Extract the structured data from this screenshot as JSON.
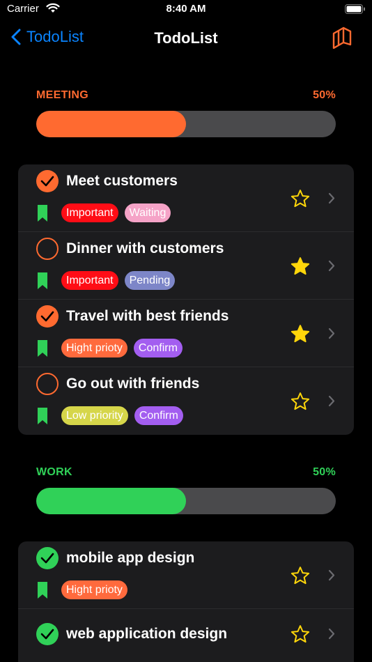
{
  "status_bar": {
    "carrier": "Carrier",
    "time": "8:40 AM"
  },
  "nav": {
    "back_label": "TodoList",
    "title": "TodoList",
    "action_icon": "cards-stack-icon"
  },
  "colors": {
    "accent_orange": "#ff6a30",
    "accent_green": "#30d158",
    "star_yellow": "#ffd60a",
    "bookmark_green": "#30d158"
  },
  "sections": [
    {
      "name": "MEETING",
      "percent_label": "50%",
      "progress": 0.5,
      "color": "#ff6a30",
      "items": [
        {
          "title": "Meet customers",
          "done": true,
          "starred": false,
          "tags": [
            {
              "label": "Important",
              "color": "#ff0d16"
            },
            {
              "label": "Waiting",
              "color": "#f5a3c7"
            }
          ]
        },
        {
          "title": "Dinner with customers",
          "done": false,
          "starred": true,
          "tags": [
            {
              "label": "Important",
              "color": "#ff0d16"
            },
            {
              "label": "Pending",
              "color": "#7d86c8"
            }
          ]
        },
        {
          "title": "Travel with best friends",
          "done": true,
          "starred": true,
          "tags": [
            {
              "label": "Hight prioty",
              "color": "#ff6a3d"
            },
            {
              "label": "Confirm",
              "color": "#a35ef0"
            }
          ]
        },
        {
          "title": "Go out with friends",
          "done": false,
          "starred": false,
          "tags": [
            {
              "label": "Low priority",
              "color": "#d6d64a"
            },
            {
              "label": "Confirm",
              "color": "#a35ef0"
            }
          ]
        }
      ]
    },
    {
      "name": "WORK",
      "percent_label": "50%",
      "progress": 0.5,
      "color": "#30d158",
      "items": [
        {
          "title": "mobile app design",
          "done": true,
          "starred": false,
          "tags": [
            {
              "label": "Hight prioty",
              "color": "#ff6a3d"
            }
          ]
        },
        {
          "title": "web application design",
          "done": true,
          "starred": false,
          "tags": []
        }
      ]
    }
  ]
}
